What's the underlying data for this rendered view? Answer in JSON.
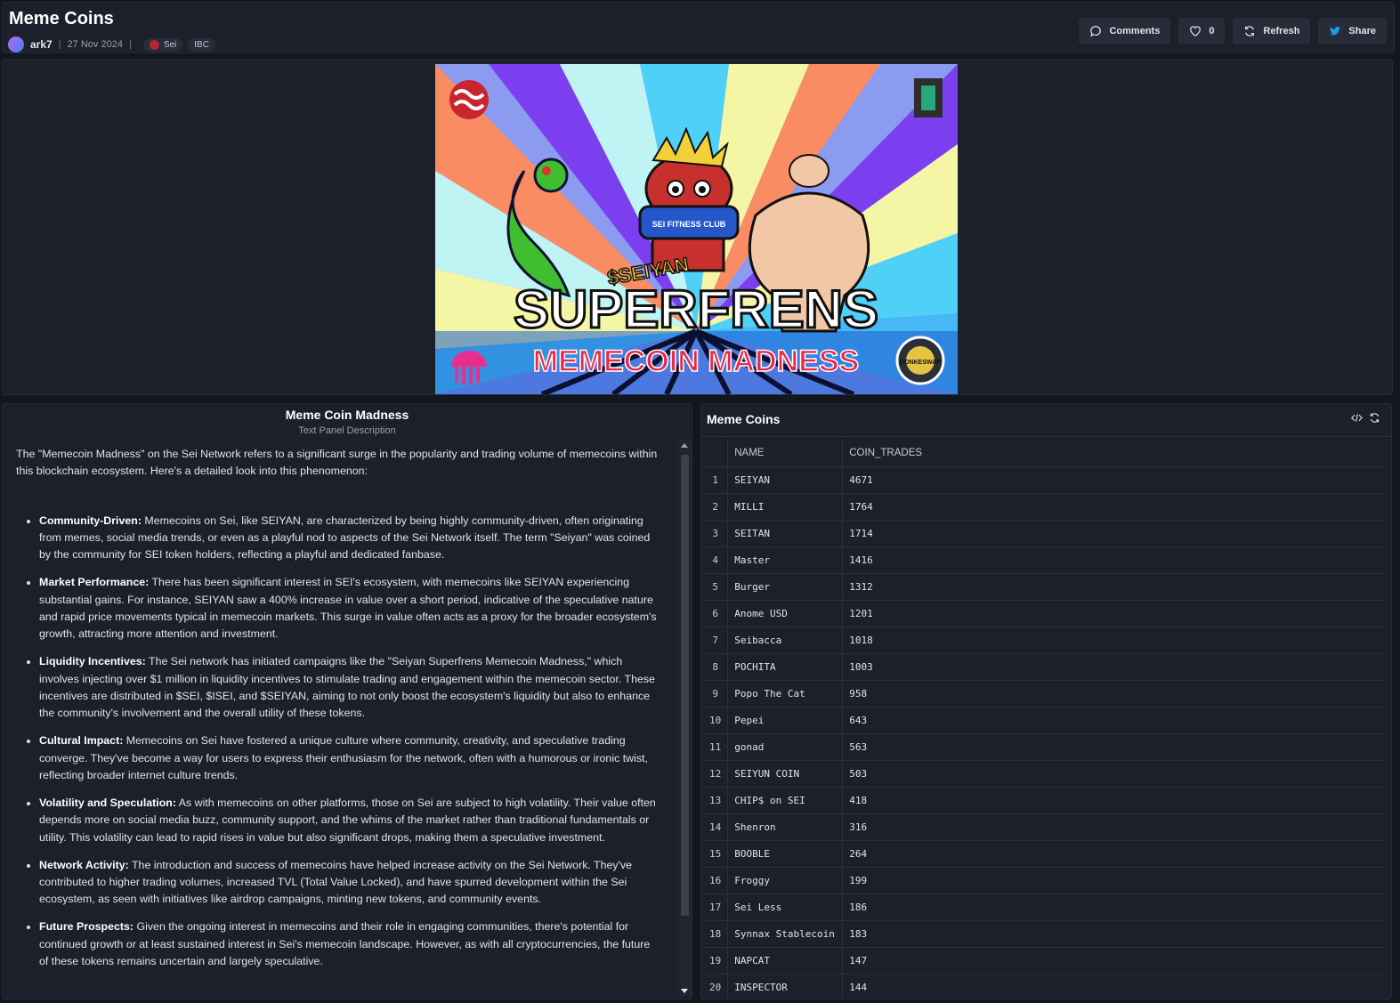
{
  "header": {
    "title": "Meme Coins",
    "author": "ark7",
    "date": "27 Nov 2024",
    "tags": [
      "Sei",
      "IBC"
    ],
    "buttons": {
      "comments": "Comments",
      "likes": "0",
      "refresh": "Refresh",
      "share": "Share"
    }
  },
  "banner": {
    "line1": "SUPERFRENS",
    "line2": "MEMECOIN MADNESS",
    "small_text": "$SEIYAN",
    "shirt_text": "SEI FITNESS CLUB",
    "badge_text": "DONKESWAP"
  },
  "text_panel": {
    "title": "Meme Coin Madness",
    "subtitle": "Text Panel Description",
    "intro": "The \"Memecoin Madness\" on the Sei Network refers to a significant surge in the popularity and trading volume of memecoins within this blockchain ecosystem. Here's a detailed look into this phenomenon:",
    "items": [
      {
        "head": "Community-Driven:",
        "text": " Memecoins on Sei, like SEIYAN, are characterized by being highly community-driven, often originating from memes, social media trends, or even as a playful nod to aspects of the Sei Network itself. The term \"Seiyan\" was coined by the community for SEI token holders, reflecting a playful and dedicated fanbase."
      },
      {
        "head": "Market Performance:",
        "text": " There has been significant interest in SEI's ecosystem, with memecoins like SEIYAN experiencing substantial gains. For instance, SEIYAN saw a 400% increase in value over a short period, indicative of the speculative nature and rapid price movements typical in memecoin markets. This surge in value often acts as a proxy for the broader ecosystem's growth, attracting more attention and investment."
      },
      {
        "head": "Liquidity Incentives:",
        "text": " The Sei network has initiated campaigns like the \"Seiyan Superfrens Memecoin Madness,\" which involves injecting over $1 million in liquidity incentives to stimulate trading and engagement within the memecoin sector. These incentives are distributed in $SEI, $ISEI, and $SEIYAN, aiming to not only boost the ecosystem's liquidity but also to enhance the community's involvement and the overall utility of these tokens."
      },
      {
        "head": "Cultural Impact:",
        "text": " Memecoins on Sei have fostered a unique culture where community, creativity, and speculative trading converge. They've become a way for users to express their enthusiasm for the network, often with a humorous or ironic twist, reflecting broader internet culture trends."
      },
      {
        "head": "Volatility and Speculation:",
        "text": " As with memecoins on other platforms, those on Sei are subject to high volatility. Their value often depends more on social media buzz, community support, and the whims of the market rather than traditional fundamentals or utility. This volatility can lead to rapid rises in value but also significant drops, making them a speculative investment."
      },
      {
        "head": "Network Activity:",
        "text": " The introduction and success of memecoins have helped increase activity on the Sei Network. They've contributed to higher trading volumes, increased TVL (Total Value Locked), and have spurred development within the Sei ecosystem, as seen with initiatives like airdrop campaigns, minting new tokens, and community events."
      },
      {
        "head": "Future Prospects:",
        "text": " Given the ongoing interest in memecoins and their role in engaging communities, there's potential for continued growth or at least sustained interest in Sei's memecoin landscape. However, as with all cryptocurrencies, the future of these tokens remains uncertain and largely speculative."
      }
    ]
  },
  "table_panel": {
    "title": "Meme Coins",
    "columns": [
      "NAME",
      "COIN_TRADES"
    ],
    "rows": [
      [
        "1",
        "SEIYAN",
        "4671"
      ],
      [
        "2",
        "MILLI",
        "1764"
      ],
      [
        "3",
        "SEITAN",
        "1714"
      ],
      [
        "4",
        "Master",
        "1416"
      ],
      [
        "5",
        "Burger",
        "1312"
      ],
      [
        "6",
        "Anome USD",
        "1201"
      ],
      [
        "7",
        "Seibacca",
        "1018"
      ],
      [
        "8",
        "POCHITA",
        "1003"
      ],
      [
        "9",
        "Popo The Cat",
        "958"
      ],
      [
        "10",
        "Pepei",
        "643"
      ],
      [
        "11",
        "gonad",
        "563"
      ],
      [
        "12",
        "SEIYUN COIN",
        "503"
      ],
      [
        "13",
        "CHIP$ on SEI",
        "418"
      ],
      [
        "14",
        "Shenron",
        "316"
      ],
      [
        "15",
        "BOOBLE",
        "264"
      ],
      [
        "16",
        "Froggy",
        "199"
      ],
      [
        "17",
        "Sei Less",
        "186"
      ],
      [
        "18",
        "Synnax Stablecoin",
        "183"
      ],
      [
        "19",
        "NAPCAT",
        "147"
      ],
      [
        "20",
        "INSPECTOR",
        "144"
      ]
    ]
  }
}
